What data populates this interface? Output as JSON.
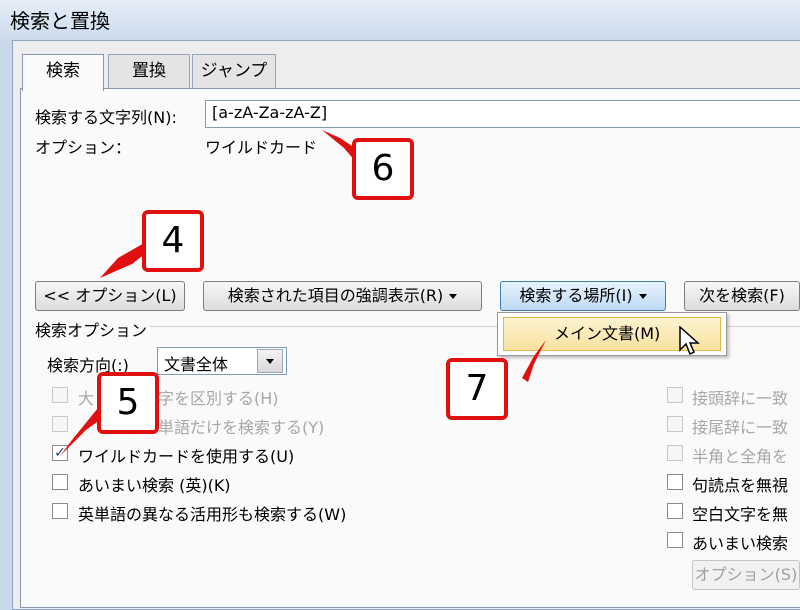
{
  "window": {
    "title": "検索と置換"
  },
  "tabs": [
    {
      "label": "検索",
      "active": true
    },
    {
      "label": "置換",
      "active": false
    },
    {
      "label": "ジャンプ",
      "active": false
    }
  ],
  "find": {
    "label": "検索する文字列(N):",
    "value": "[a-zA-Za-zA-Z]"
  },
  "options_info": {
    "label": "オプション：",
    "value": "ワイルドカード"
  },
  "buttons": {
    "less_options": "<< オプション(L)",
    "highlight": "検索された項目の強調表示(R)",
    "find_in": "検索する場所(I)",
    "find_next": "次を検索(F)",
    "options": "オプション(S)"
  },
  "find_in_menu": {
    "items": [
      {
        "label": "メイン文書(M)"
      }
    ]
  },
  "search_options": {
    "header": "検索オプション",
    "direction_label": "検索方向(:)",
    "direction_value": "文書全体",
    "left": [
      {
        "label": "大　　　文字を区別する(H)",
        "checked": false,
        "disabled": true
      },
      {
        "label": "　　　する単語だけを検索する(Y)",
        "checked": false,
        "disabled": true
      },
      {
        "label": "ワイルドカードを使用する(U)",
        "checked": true,
        "disabled": false
      },
      {
        "label": "あいまい検索 (英)(K)",
        "checked": false,
        "disabled": false
      },
      {
        "label": "英単語の異なる活用形も検索する(W)",
        "checked": false,
        "disabled": false
      }
    ],
    "right": [
      {
        "label": "接頭辞に一致",
        "checked": false,
        "disabled": true
      },
      {
        "label": "接尾辞に一致",
        "checked": false,
        "disabled": true
      },
      {
        "label": "半角と全角を",
        "checked": false,
        "disabled": true
      },
      {
        "label": "句読点を無視",
        "checked": false,
        "disabled": false
      },
      {
        "label": "空白文字を無",
        "checked": false,
        "disabled": false
      },
      {
        "label": "あいまい検索",
        "checked": false,
        "disabled": false
      }
    ]
  },
  "callouts": [
    "4",
    "5",
    "6",
    "7"
  ],
  "colors": {
    "callout": "#e01010",
    "menu_highlight": "#f9e2a0",
    "hot_button": "#bfdaf5"
  }
}
